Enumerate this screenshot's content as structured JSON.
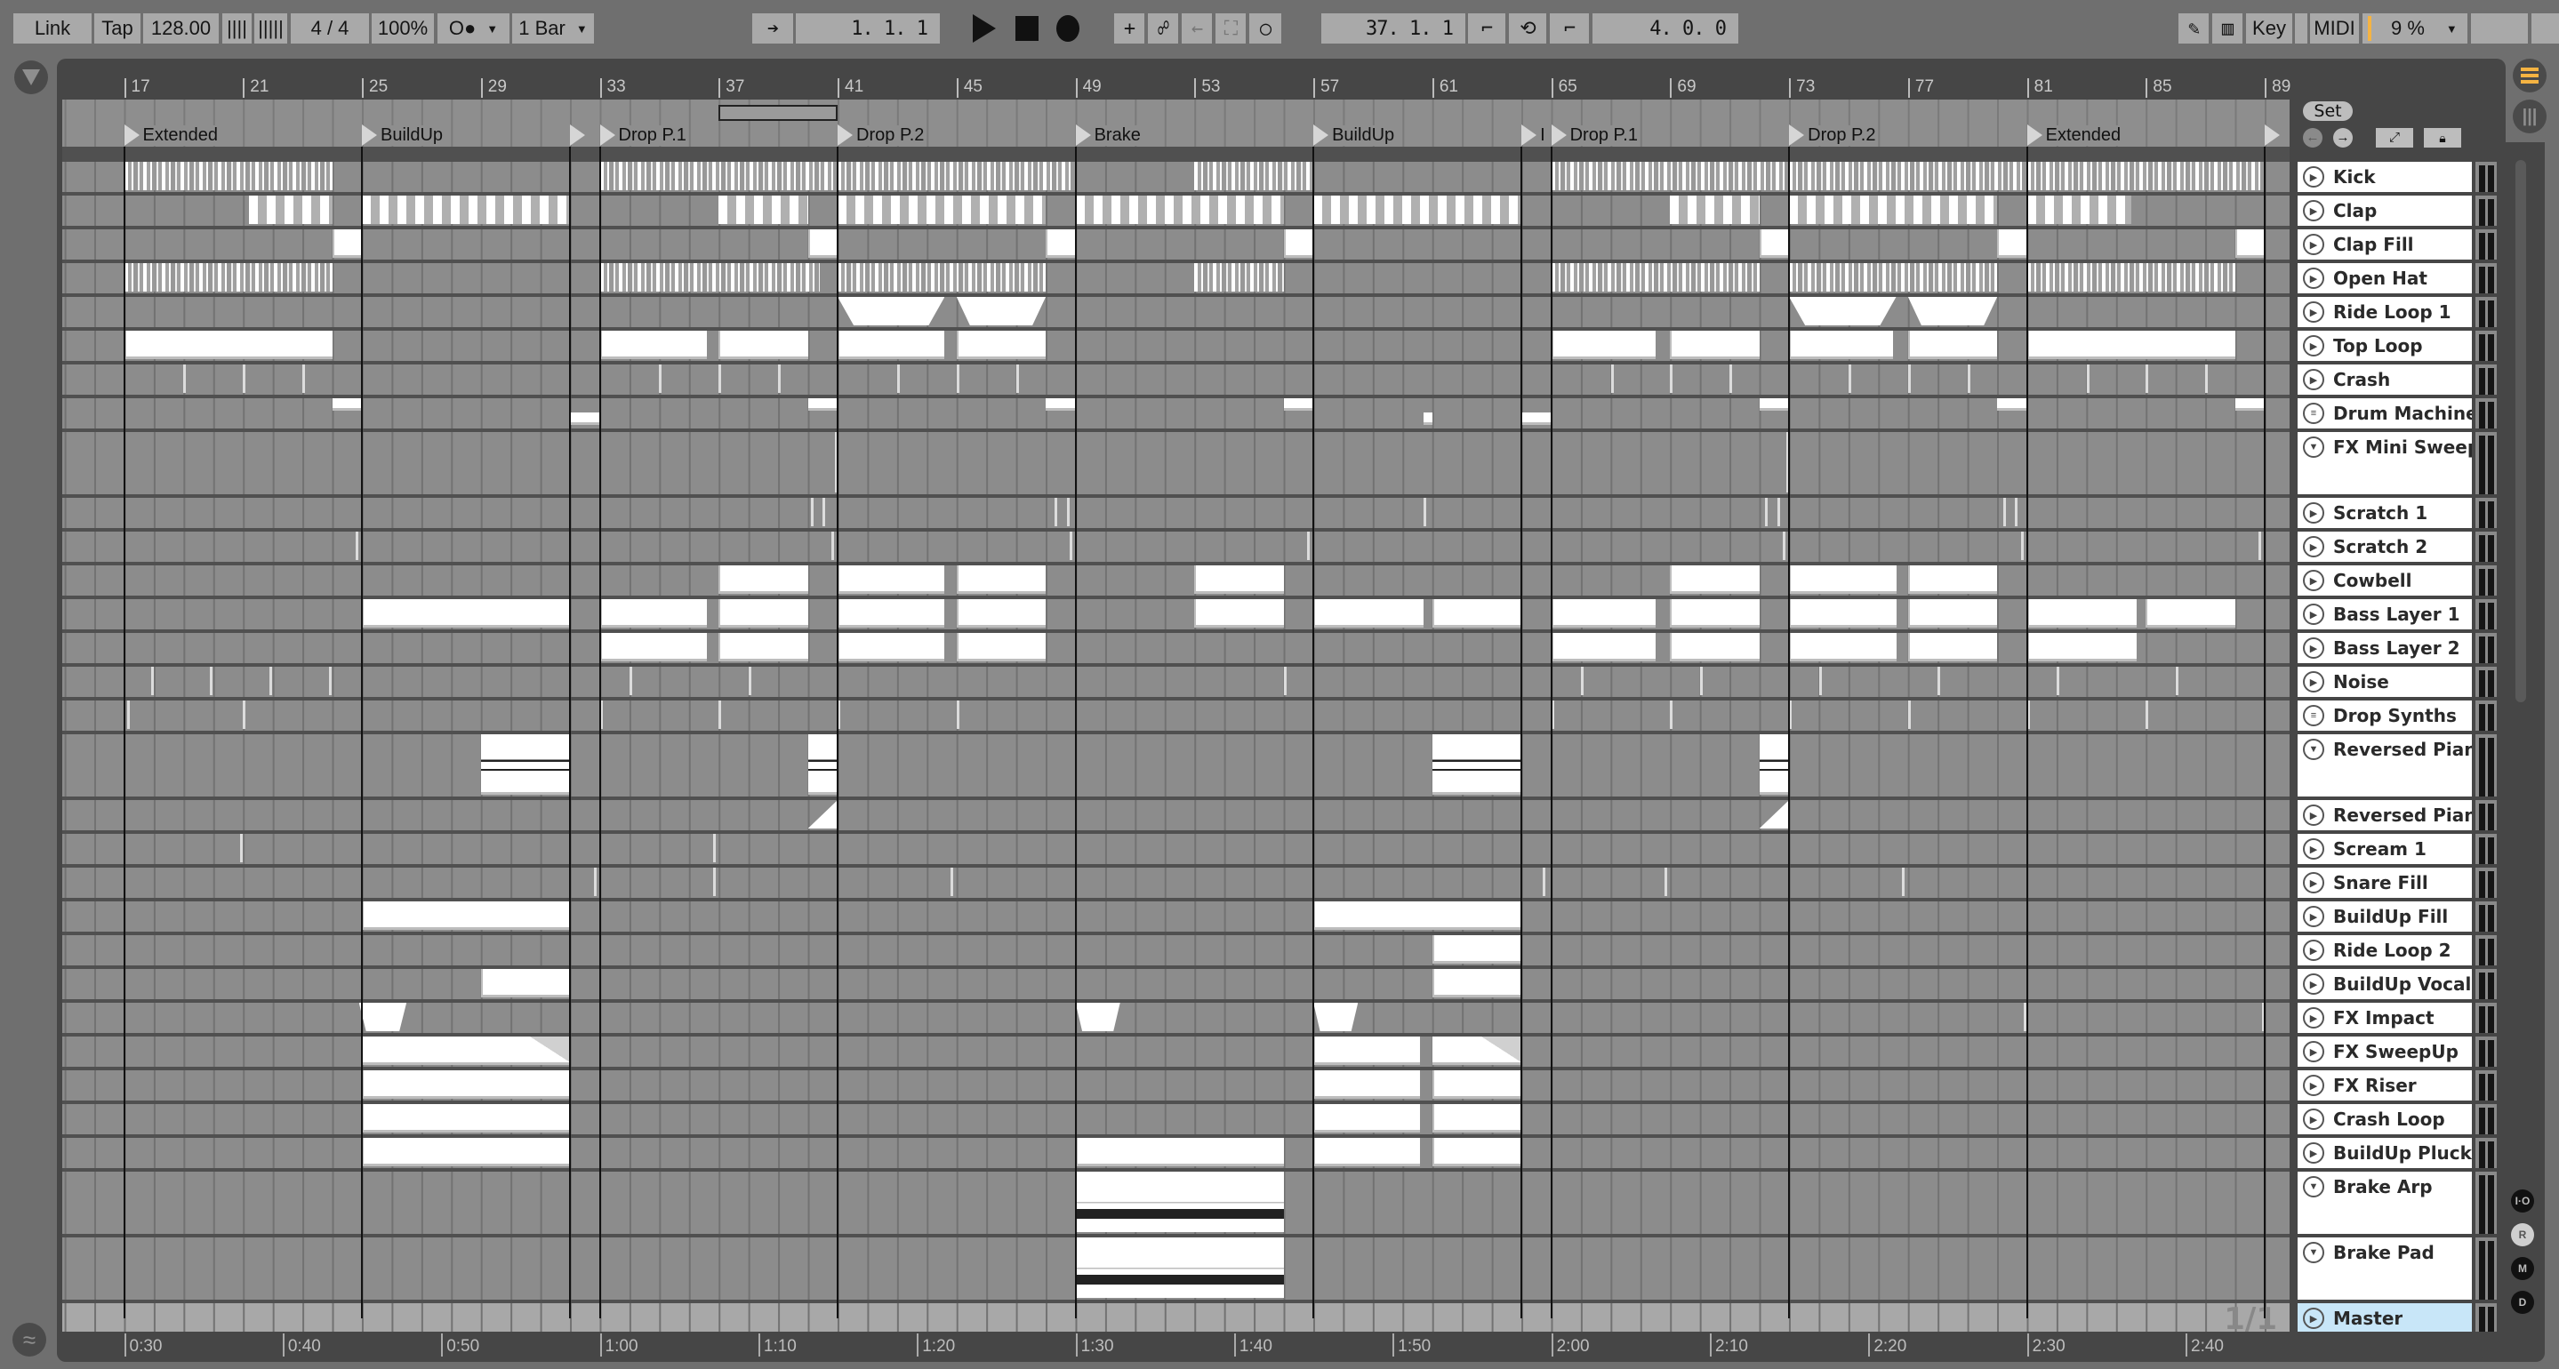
{
  "toolbar": {
    "link": "Link",
    "tap": "Tap",
    "tempo": "128.00",
    "time_signature": "4 / 4",
    "groove": "100%",
    "metronome": "O●",
    "quantize": "1 Bar",
    "position": "1.  1.  1",
    "loop_start": "37.  1.  1",
    "loop_length": "4.  0.  0",
    "key": "Key",
    "midi": "MIDI",
    "cpu": "9 %"
  },
  "colors": {
    "accent": "#f5b342",
    "master": "#c8e6f8",
    "clip": "#ffffff",
    "lane": "#8c8c8c"
  },
  "browser": {
    "set_label": "Set"
  },
  "ruler": {
    "bars": [
      "17",
      "21",
      "25",
      "29",
      "33",
      "37",
      "41",
      "45",
      "49",
      "53",
      "57",
      "61",
      "65",
      "69",
      "73",
      "77",
      "81",
      "85",
      "89"
    ]
  },
  "loop": {
    "start": 37,
    "end": 41
  },
  "locators": [
    {
      "bar": 17,
      "label": "Extended"
    },
    {
      "bar": 25,
      "label": "BuildUp"
    },
    {
      "bar": 32,
      "label": ""
    },
    {
      "bar": 33,
      "label": "Drop P.1"
    },
    {
      "bar": 41,
      "label": "Drop P.2"
    },
    {
      "bar": 49,
      "label": "Brake"
    },
    {
      "bar": 57,
      "label": "BuildUp"
    },
    {
      "bar": 64,
      "label": "I"
    },
    {
      "bar": 65,
      "label": "Drop P.1"
    },
    {
      "bar": 73,
      "label": "Drop P.2"
    },
    {
      "bar": 81,
      "label": "Extended"
    },
    {
      "bar": 89,
      "label": ""
    }
  ],
  "time_labels": [
    "0:30",
    "0:40",
    "0:50",
    "1:00",
    "1:10",
    "1:20",
    "1:30",
    "1:40",
    "1:50",
    "2:00",
    "2:10",
    "2:20",
    "2:30",
    "2:40"
  ],
  "master": {
    "name": "Master",
    "page": "1/1"
  },
  "side_buttons": [
    "I·O",
    "R",
    "M",
    "D"
  ],
  "tracks": [
    {
      "name": "Kick",
      "icon": "play",
      "clips": [
        [
          17,
          24,
          "stripes"
        ],
        [
          33,
          41,
          "stripes"
        ],
        [
          41,
          49,
          "stripes"
        ],
        [
          53,
          57,
          "stripes"
        ],
        [
          65,
          73,
          "stripes"
        ],
        [
          73,
          81,
          "stripes"
        ],
        [
          81,
          89,
          "stripes"
        ]
      ]
    },
    {
      "name": "Clap",
      "icon": "play",
      "clips": [
        [
          21.2,
          24,
          "bars"
        ],
        [
          25,
          32,
          "bars"
        ],
        [
          37,
          40,
          "bars"
        ],
        [
          41,
          48,
          "bars"
        ],
        [
          49,
          56,
          "bars"
        ],
        [
          57,
          64,
          "bars"
        ],
        [
          69,
          72,
          "bars"
        ],
        [
          73,
          80,
          "bars"
        ],
        [
          81,
          84.5,
          "bars"
        ]
      ]
    },
    {
      "name": "Clap Fill",
      "icon": "play",
      "clips": [
        [
          24,
          25,
          "block"
        ],
        [
          40,
          41,
          "block"
        ],
        [
          48,
          49,
          "block"
        ],
        [
          56,
          57,
          "block"
        ],
        [
          72,
          73,
          "block"
        ],
        [
          80,
          81,
          "block"
        ],
        [
          88,
          89,
          "block"
        ]
      ]
    },
    {
      "name": "Open Hat",
      "icon": "play",
      "clips": [
        [
          17,
          24,
          "stripes"
        ],
        [
          33,
          40.4,
          "stripes"
        ],
        [
          41,
          48,
          "stripes"
        ],
        [
          53,
          56,
          "stripes"
        ],
        [
          65,
          72,
          "stripes"
        ],
        [
          73,
          80,
          "stripes"
        ],
        [
          81,
          88,
          "stripes"
        ]
      ]
    },
    {
      "name": "Ride Loop 1",
      "icon": "play",
      "clips": [
        [
          41,
          44.6,
          "fade"
        ],
        [
          45,
          48,
          "fade"
        ],
        [
          73,
          76.6,
          "fade"
        ],
        [
          77,
          80,
          "fade"
        ]
      ]
    },
    {
      "name": "Top Loop",
      "icon": "play",
      "clips": [
        [
          17,
          24,
          "block"
        ],
        [
          33,
          36.6,
          "block"
        ],
        [
          37,
          40,
          "block"
        ],
        [
          41,
          44.6,
          "block"
        ],
        [
          45,
          48,
          "block"
        ],
        [
          65,
          68.5,
          "block"
        ],
        [
          69,
          72,
          "block"
        ],
        [
          73,
          76.5,
          "block"
        ],
        [
          77,
          80,
          "block"
        ],
        [
          81,
          88,
          "block"
        ]
      ]
    },
    {
      "name": "Crash",
      "icon": "play",
      "clips": [
        [
          19,
          19.1,
          "tick"
        ],
        [
          21,
          21.1,
          "tick"
        ],
        [
          23,
          23.1,
          "tick"
        ],
        [
          35,
          35.1,
          "tick"
        ],
        [
          37,
          37.1,
          "tick"
        ],
        [
          39,
          39.1,
          "tick"
        ],
        [
          43,
          43.1,
          "tick"
        ],
        [
          45,
          45.1,
          "tick"
        ],
        [
          47,
          47.1,
          "tick"
        ],
        [
          67,
          67.1,
          "tick"
        ],
        [
          69,
          69.1,
          "tick"
        ],
        [
          71,
          71.1,
          "tick"
        ],
        [
          75,
          75.1,
          "tick"
        ],
        [
          77,
          77.1,
          "tick"
        ],
        [
          79,
          79.1,
          "tick"
        ],
        [
          83,
          83.1,
          "tick"
        ],
        [
          85,
          85.1,
          "tick"
        ],
        [
          87,
          87.1,
          "tick"
        ]
      ]
    },
    {
      "name": "Drum Machine",
      "icon": "list",
      "clips": [
        [
          24,
          25,
          "halftop"
        ],
        [
          32,
          33,
          "halfbot"
        ],
        [
          40,
          41,
          "halftop"
        ],
        [
          48,
          49,
          "halftop"
        ],
        [
          56,
          57,
          "halftop"
        ],
        [
          60.7,
          61,
          "halfbot"
        ],
        [
          64,
          65,
          "halfbot"
        ],
        [
          72,
          73,
          "halftop"
        ],
        [
          80,
          81,
          "halftop"
        ],
        [
          88,
          89,
          "halftop"
        ]
      ]
    },
    {
      "name": "FX Mini Sweep",
      "icon": "down",
      "expanded": true,
      "clips": [
        [
          40.9,
          41,
          "tick"
        ],
        [
          72.9,
          73,
          "tick"
        ]
      ]
    },
    {
      "name": "Scratch 1",
      "icon": "play",
      "clips": [
        [
          40.1,
          40.2,
          "tick"
        ],
        [
          40.5,
          40.6,
          "tick"
        ],
        [
          48.3,
          48.4,
          "tick"
        ],
        [
          48.7,
          48.8,
          "tick"
        ],
        [
          60.7,
          60.8,
          "tick"
        ],
        [
          72.2,
          72.3,
          "tick"
        ],
        [
          72.6,
          72.7,
          "tick"
        ],
        [
          80.2,
          80.3,
          "tick"
        ],
        [
          80.6,
          80.7,
          "tick"
        ]
      ]
    },
    {
      "name": "Scratch 2",
      "icon": "play",
      "clips": [
        [
          24.8,
          24.9,
          "tick"
        ],
        [
          40.8,
          40.9,
          "tick"
        ],
        [
          48.8,
          48.9,
          "tick"
        ],
        [
          56.8,
          56.9,
          "tick"
        ],
        [
          72.8,
          72.9,
          "tick"
        ],
        [
          80.8,
          80.9,
          "tick"
        ],
        [
          88.8,
          88.9,
          "tick"
        ]
      ]
    },
    {
      "name": "Cowbell",
      "icon": "play",
      "clips": [
        [
          37,
          40,
          "block"
        ],
        [
          41,
          44.6,
          "block"
        ],
        [
          45,
          48,
          "block"
        ],
        [
          53,
          56,
          "block"
        ],
        [
          69,
          72,
          "block"
        ],
        [
          73,
          76.6,
          "block"
        ],
        [
          77,
          80,
          "block"
        ]
      ]
    },
    {
      "name": "Bass Layer 1",
      "icon": "play",
      "clips": [
        [
          25,
          32,
          "block"
        ],
        [
          33,
          36.6,
          "block"
        ],
        [
          37,
          40,
          "block"
        ],
        [
          41,
          44.6,
          "block"
        ],
        [
          45,
          48,
          "block"
        ],
        [
          53,
          56,
          "block"
        ],
        [
          57,
          60.7,
          "block"
        ],
        [
          61,
          64,
          "block"
        ],
        [
          65,
          68.5,
          "block"
        ],
        [
          69,
          72,
          "block"
        ],
        [
          73,
          76.6,
          "block"
        ],
        [
          77,
          80,
          "block"
        ],
        [
          81,
          84.7,
          "block"
        ],
        [
          85,
          88,
          "block"
        ]
      ]
    },
    {
      "name": "Bass Layer 2",
      "icon": "play",
      "clips": [
        [
          33,
          36.6,
          "block"
        ],
        [
          37,
          40,
          "block"
        ],
        [
          41,
          44.6,
          "block"
        ],
        [
          45,
          48,
          "block"
        ],
        [
          65,
          68.5,
          "block"
        ],
        [
          69,
          72,
          "block"
        ],
        [
          73,
          76.6,
          "block"
        ],
        [
          77,
          80,
          "block"
        ],
        [
          81,
          84.7,
          "block"
        ]
      ]
    },
    {
      "name": "Noise",
      "icon": "play",
      "clips": [
        [
          17.9,
          18,
          "tick"
        ],
        [
          19.9,
          20,
          "tick"
        ],
        [
          21.9,
          22,
          "tick"
        ],
        [
          23.9,
          24,
          "tick"
        ],
        [
          34,
          34.1,
          "tick"
        ],
        [
          38,
          38.1,
          "tick"
        ],
        [
          56,
          56.1,
          "tick"
        ],
        [
          66,
          66.1,
          "tick"
        ],
        [
          70,
          70.1,
          "tick"
        ],
        [
          74,
          74.1,
          "tick"
        ],
        [
          78,
          78.1,
          "tick"
        ],
        [
          82,
          82.1,
          "tick"
        ],
        [
          86,
          86.1,
          "tick"
        ]
      ]
    },
    {
      "name": "Drop Synths",
      "icon": "list",
      "clips": [
        [
          17.1,
          17.2,
          "tick"
        ],
        [
          21,
          21.2,
          "tick"
        ],
        [
          33,
          33.1,
          "tick"
        ],
        [
          37,
          37.2,
          "tick"
        ],
        [
          41,
          41.1,
          "tick"
        ],
        [
          45,
          45.2,
          "tick"
        ],
        [
          65,
          65.1,
          "tick"
        ],
        [
          69,
          69.2,
          "tick"
        ],
        [
          73,
          73.1,
          "tick"
        ],
        [
          77,
          77.2,
          "tick"
        ],
        [
          81,
          81.1,
          "tick"
        ],
        [
          85,
          85.2,
          "tick"
        ]
      ]
    },
    {
      "name": "Reversed Pian",
      "icon": "down",
      "expanded": true,
      "clips": [
        [
          29,
          32,
          "piano"
        ],
        [
          40,
          41,
          "piano"
        ],
        [
          61,
          64,
          "piano"
        ],
        [
          72,
          73,
          "piano"
        ]
      ]
    },
    {
      "name": "Reversed Pian",
      "icon": "play",
      "clips": [
        [
          40,
          41,
          "fadein"
        ],
        [
          72,
          73,
          "fadein"
        ]
      ]
    },
    {
      "name": "Scream 1",
      "icon": "play",
      "clips": [
        [
          20.9,
          21,
          "tick"
        ],
        [
          36.8,
          36.9,
          "tick"
        ]
      ]
    },
    {
      "name": "Snare Fill",
      "icon": "play",
      "clips": [
        [
          32.8,
          32.9,
          "tick"
        ],
        [
          36.8,
          36.9,
          "tick"
        ],
        [
          44.8,
          44.9,
          "tick"
        ],
        [
          64.7,
          64.8,
          "tick"
        ],
        [
          68.8,
          68.9,
          "tick"
        ],
        [
          76.8,
          76.9,
          "tick"
        ]
      ]
    },
    {
      "name": "BuildUp Fill",
      "icon": "play",
      "clips": [
        [
          25,
          32,
          "block"
        ],
        [
          57,
          64,
          "block"
        ]
      ]
    },
    {
      "name": "Ride Loop 2",
      "icon": "play",
      "clips": [
        [
          61,
          64,
          "block"
        ]
      ]
    },
    {
      "name": "BuildUp Vocal",
      "icon": "play",
      "clips": [
        [
          29,
          32,
          "block"
        ],
        [
          61,
          64,
          "block"
        ]
      ]
    },
    {
      "name": "FX Impact",
      "icon": "play",
      "clips": [
        [
          24.9,
          26.5,
          "fade"
        ],
        [
          49,
          50.5,
          "fade"
        ],
        [
          57,
          58.5,
          "fade"
        ],
        [
          80.9,
          81,
          "tick"
        ],
        [
          88.9,
          89,
          "tick"
        ]
      ]
    },
    {
      "name": "FX SweepUp",
      "icon": "play",
      "clips": [
        [
          25,
          32,
          "fadeout"
        ],
        [
          57,
          60.6,
          "block"
        ],
        [
          61,
          64,
          "fadeout"
        ]
      ]
    },
    {
      "name": "FX Riser",
      "icon": "play",
      "clips": [
        [
          25,
          32,
          "block"
        ],
        [
          57,
          60.6,
          "block"
        ],
        [
          61,
          64,
          "block"
        ]
      ]
    },
    {
      "name": "Crash Loop",
      "icon": "play",
      "clips": [
        [
          25,
          32,
          "block"
        ],
        [
          57,
          60.6,
          "block"
        ],
        [
          61,
          64,
          "block"
        ]
      ]
    },
    {
      "name": "BuildUp Pluck",
      "icon": "play",
      "clips": [
        [
          25,
          32,
          "block"
        ],
        [
          49,
          56,
          "block"
        ],
        [
          57,
          60.6,
          "block"
        ],
        [
          61,
          64,
          "block"
        ]
      ]
    },
    {
      "name": "Brake Arp",
      "icon": "down",
      "expanded": true,
      "clips": [
        [
          49,
          56,
          "midi"
        ]
      ]
    },
    {
      "name": "Brake Pad",
      "icon": "down",
      "expanded": true,
      "clips": [
        [
          49,
          56,
          "midi"
        ]
      ]
    }
  ]
}
